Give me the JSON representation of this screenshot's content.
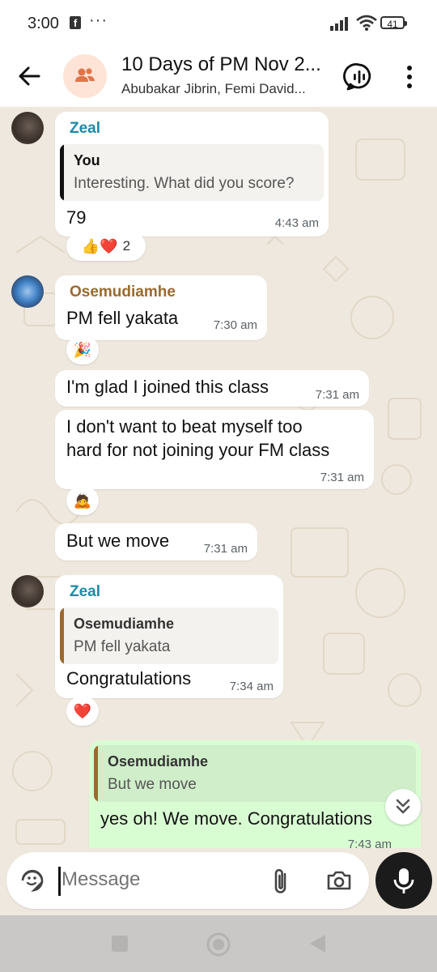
{
  "status_bar": {
    "time": "3:00",
    "fb_icon": "f",
    "more": "···",
    "battery": "41"
  },
  "header": {
    "title": "10 Days of PM Nov 2...",
    "subtitle": "Abubakar Jibrin, Femi David..."
  },
  "messages": [
    {
      "sender": "Zeal",
      "sender_color": "#1d8aa6",
      "quote_name": "You",
      "quote_text": "Interesting. What did you score?",
      "text": "79",
      "time": "4:43 am",
      "reactions": "👍❤️",
      "reaction_count": "2"
    },
    {
      "sender": "Osemudiamhe",
      "sender_color": "#9a6a2f",
      "text": "PM fell yakata",
      "time": "7:30 am",
      "reactions": "🎉"
    },
    {
      "text": "I'm glad I joined this class",
      "time": "7:31 am"
    },
    {
      "text_line1": "I don't want to beat myself too",
      "text_line2": "hard for not joining your FM class",
      "time": "7:31 am",
      "reactions": "🙇"
    },
    {
      "text": "But we move",
      "time": "7:31 am"
    },
    {
      "sender": "Zeal",
      "sender_color": "#1d8aa6",
      "quote_name": "Osemudiamhe",
      "quote_text": "PM fell yakata",
      "text": "Congratulations",
      "time": "7:34 am",
      "reactions": "❤️"
    },
    {
      "quote_name": "Osemudiamhe",
      "quote_text": "But we move",
      "text": "yes oh! We move. Congratulations",
      "time": "7:43 am"
    }
  ],
  "input": {
    "placeholder": "Message"
  },
  "colors": {
    "outgoing_bubble": "#d9fdd3",
    "incoming_bubble": "#ffffff",
    "chat_bg": "#efe8de",
    "quote_bar_you": "#111111",
    "quote_bar_ose": "#9a6a2f"
  },
  "icons": [
    "back-arrow-icon",
    "group-icon",
    "voice-chat-icon",
    "more-vert-icon",
    "sticker-icon",
    "attach-icon",
    "camera-icon",
    "mic-icon",
    "scroll-down-icon",
    "nav-square-icon",
    "nav-home-icon",
    "nav-back-icon"
  ]
}
